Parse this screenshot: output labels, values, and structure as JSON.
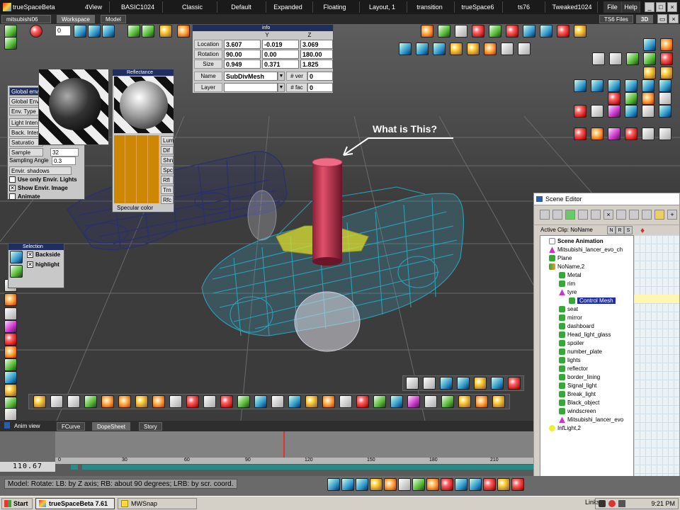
{
  "app": {
    "title": "trueSpaceBeta 7.61",
    "file_menu": "File",
    "help_menu": "Help",
    "ts6_files": "TS6 Files",
    "view_3d": "3D"
  },
  "layout_tabs": [
    "4View",
    "BASIC1024",
    "Classic",
    "Default",
    "Expanded",
    "Floating",
    "Layout, 1",
    "transition",
    "trueSpace6",
    "ts76",
    "Tweaked1024"
  ],
  "sub_tabs": [
    "mitsubishi06",
    "Workspace",
    "Model"
  ],
  "toolbar": {
    "frame_value": "0"
  },
  "info_panel": {
    "title": "info",
    "col_y": "Y",
    "col_z": "Z",
    "location_label": "Location",
    "location": [
      "3.607",
      "-0.019",
      "3.069"
    ],
    "rotation_label": "Rotation",
    "rotation": [
      "90.00",
      "0.00",
      "180.00"
    ],
    "size_label": "Size",
    "size": [
      "0.949",
      "0.371",
      "1.825"
    ],
    "name_label": "Name",
    "name_value": "SubDivMesh",
    "ver_label": "# ver",
    "ver_value": "0",
    "layer_label": "Layer",
    "fac_label": "# fac",
    "fac_value": "0"
  },
  "env_panel": {
    "title": "Global env",
    "buttons": [
      "Global Env",
      "Env. Type",
      "Light Inten",
      "Back. Inten",
      "Saturatio",
      "Sample"
    ],
    "sample_value": "32",
    "sampling_angle_label": "Sampling Angle",
    "sampling_angle_value": "0.3",
    "envir_shadows": "Envir. shadows",
    "use_only_envir_lights": "Use only Envir. Lights",
    "show_envir_image": "Show Envir. Image",
    "animate": "Animate"
  },
  "reflectance_panel": {
    "title": "Reflectance",
    "buttons": [
      "Lum",
      "Dif",
      "Shn",
      "Spc",
      "Rfl",
      "Trn",
      "Rfc"
    ],
    "specular_color": "Specular color"
  },
  "selection_panel": {
    "title": "Selection",
    "backside": "Backside",
    "highlight": "highlight"
  },
  "annotation": {
    "text": "What is This?"
  },
  "scene_editor": {
    "title": "Scene Editor",
    "active_clip_label": "Active Clip: NoName",
    "items": [
      {
        "label": "Scene Animation",
        "indent": 0,
        "icon": "scene",
        "bold": true
      },
      {
        "label": "Mitsubishi_lancer_evo_ch",
        "indent": 0,
        "icon": "pink"
      },
      {
        "label": "Plane",
        "indent": 0,
        "icon": "green"
      },
      {
        "label": "NoName,2",
        "indent": 0,
        "icon": "multi"
      },
      {
        "label": "Metal",
        "indent": 1,
        "icon": "green"
      },
      {
        "label": "rim",
        "indent": 1,
        "icon": "green"
      },
      {
        "label": "tyre",
        "indent": 1,
        "icon": "pink"
      },
      {
        "label": "Control Mesh",
        "indent": 2,
        "icon": "green",
        "selected": true
      },
      {
        "label": "seat",
        "indent": 1,
        "icon": "green"
      },
      {
        "label": "mirror",
        "indent": 1,
        "icon": "green"
      },
      {
        "label": "dashboard",
        "indent": 1,
        "icon": "green"
      },
      {
        "label": "Head_light_glass",
        "indent": 1,
        "icon": "green"
      },
      {
        "label": "spoiler",
        "indent": 1,
        "icon": "green"
      },
      {
        "label": "number_plate",
        "indent": 1,
        "icon": "green"
      },
      {
        "label": "lights",
        "indent": 1,
        "icon": "green"
      },
      {
        "label": "reflector",
        "indent": 1,
        "icon": "green"
      },
      {
        "label": "border_lining",
        "indent": 1,
        "icon": "green"
      },
      {
        "label": "Signal_light",
        "indent": 1,
        "icon": "green"
      },
      {
        "label": "Break_light",
        "indent": 1,
        "icon": "green"
      },
      {
        "label": "Black_object",
        "indent": 1,
        "icon": "green"
      },
      {
        "label": "windscreen",
        "indent": 1,
        "icon": "green"
      },
      {
        "label": "Mitsubishi_lancer_evo",
        "indent": 1,
        "icon": "pink"
      },
      {
        "label": "InfLight,2",
        "indent": 0,
        "icon": "yellow"
      }
    ]
  },
  "anim_view": {
    "title": "Anim view",
    "tabs": [
      "FCurve",
      "DopeSheet",
      "Story"
    ],
    "ruler_ticks": [
      "0",
      "30",
      "60",
      "90",
      "120",
      "150",
      "180",
      "210"
    ],
    "frame_display": "110.67"
  },
  "status": {
    "text": "Model: Rotate: LB: by Z axis; RB: about 90 degrees; LRB: by scr. coord."
  },
  "taskbar": {
    "start": "Start",
    "items": [
      "trueSpaceBeta 7.61",
      "MWSnap"
    ],
    "links": "Links",
    "time": "9:21 PM"
  }
}
